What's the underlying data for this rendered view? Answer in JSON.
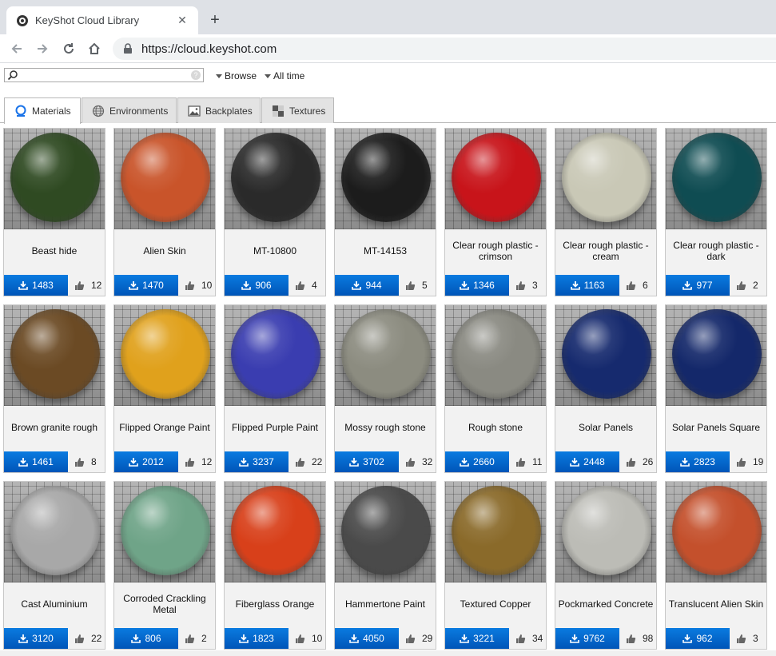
{
  "browser": {
    "tab_title": "KeyShot Cloud Library",
    "url": "https://cloud.keyshot.com"
  },
  "search": {
    "placeholder": "",
    "browse_label": "Browse",
    "time_label": "All time"
  },
  "category_tabs": [
    {
      "label": "Materials",
      "icon": "sphere-icon",
      "active": true
    },
    {
      "label": "Environments",
      "icon": "globe-icon",
      "active": false
    },
    {
      "label": "Backplates",
      "icon": "image-icon",
      "active": false
    },
    {
      "label": "Textures",
      "icon": "checker-icon",
      "active": false
    }
  ],
  "colors": {
    "download_button": "#0a6fd6",
    "accent_icon": "#1a73e8"
  },
  "materials": [
    {
      "name": "Beast hide",
      "downloads": "1483",
      "likes": "12",
      "swatch": "#2f4a22"
    },
    {
      "name": "Alien Skin",
      "downloads": "1470",
      "likes": "10",
      "swatch": "#c9542a"
    },
    {
      "name": "MT-10800",
      "downloads": "906",
      "likes": "4",
      "swatch": "#2a2a2a"
    },
    {
      "name": "MT-14153",
      "downloads": "944",
      "likes": "5",
      "swatch": "#1c1c1c"
    },
    {
      "name": "Clear rough plastic - crimson",
      "downloads": "1346",
      "likes": "3",
      "swatch": "#c8141a"
    },
    {
      "name": "Clear rough plastic - cream",
      "downloads": "1163",
      "likes": "6",
      "swatch": "#c9c8b6"
    },
    {
      "name": "Clear rough plastic - dark",
      "downloads": "977",
      "likes": "2",
      "swatch": "#0f4c52"
    },
    {
      "name": "Brown granite rough",
      "downloads": "1461",
      "likes": "8",
      "swatch": "#6b4a24"
    },
    {
      "name": "Flipped Orange Paint",
      "downloads": "2012",
      "likes": "12",
      "swatch": "#e0a11c"
    },
    {
      "name": "Flipped Purple Paint",
      "downloads": "3237",
      "likes": "22",
      "swatch": "#3a3db0"
    },
    {
      "name": "Mossy rough stone",
      "downloads": "3702",
      "likes": "32",
      "swatch": "#8c8c80"
    },
    {
      "name": "Rough stone",
      "downloads": "2660",
      "likes": "11",
      "swatch": "#8a8a82"
    },
    {
      "name": "Solar Panels",
      "downloads": "2448",
      "likes": "26",
      "swatch": "#162a6e"
    },
    {
      "name": "Solar Panels Square",
      "downloads": "2823",
      "likes": "19",
      "swatch": "#14286a"
    },
    {
      "name": "Cast Aluminium",
      "downloads": "3120",
      "likes": "22",
      "swatch": "#a8a8a8"
    },
    {
      "name": "Corroded Crackling Metal",
      "downloads": "806",
      "likes": "2",
      "swatch": "#6fa488"
    },
    {
      "name": "Fiberglass Orange",
      "downloads": "1823",
      "likes": "10",
      "swatch": "#d8401a"
    },
    {
      "name": "Hammertone Paint",
      "downloads": "4050",
      "likes": "29",
      "swatch": "#4a4a4a"
    },
    {
      "name": "Textured Copper",
      "downloads": "3221",
      "likes": "34",
      "swatch": "#8a6a2a"
    },
    {
      "name": "Pockmarked Concrete",
      "downloads": "9762",
      "likes": "98",
      "swatch": "#bcbcb6"
    },
    {
      "name": "Translucent Alien Skin",
      "downloads": "962",
      "likes": "3",
      "swatch": "#c4502c"
    }
  ]
}
